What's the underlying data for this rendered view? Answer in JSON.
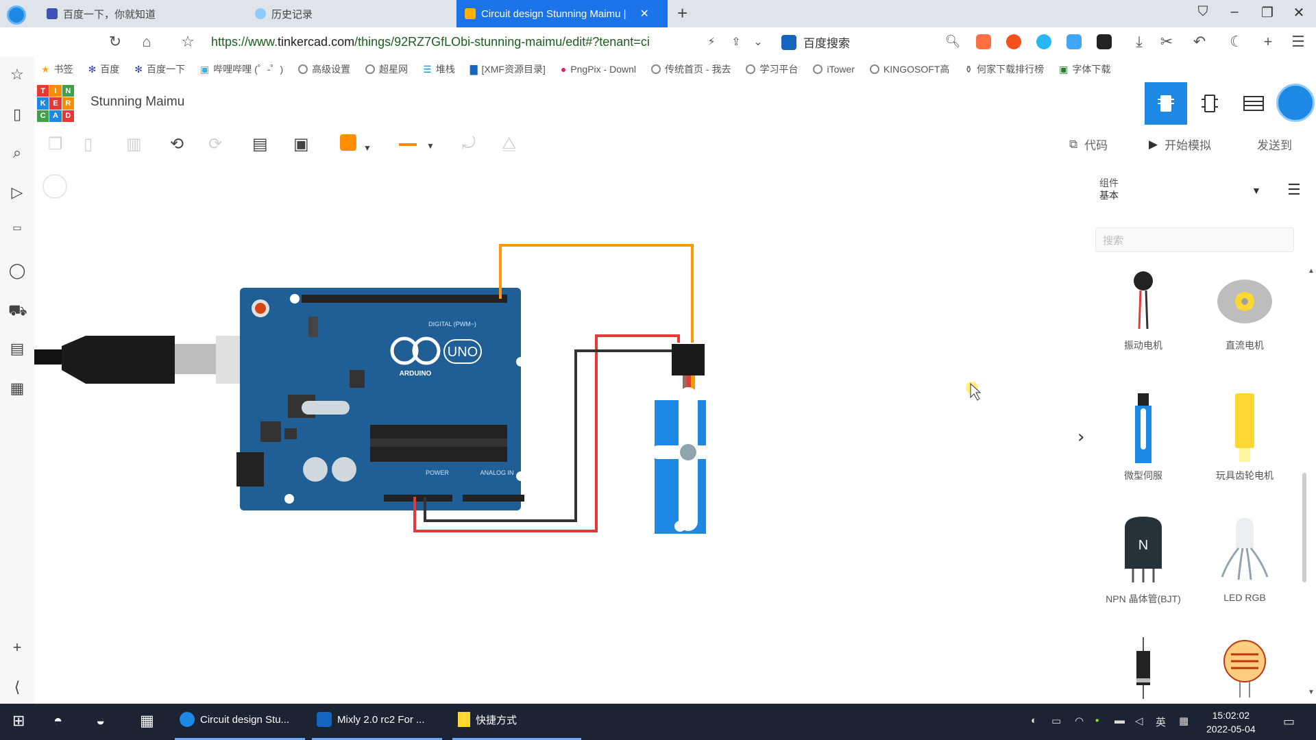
{
  "browser": {
    "tabs": [
      {
        "label": "百度一下，你就知道",
        "active": false
      },
      {
        "label": "历史记录",
        "active": false
      },
      {
        "label": "Circuit design Stunning Maimu |",
        "active": true
      }
    ],
    "url_prefix": "https://www.",
    "url_host": "tinkercad.com",
    "url_path": "/things/92RZ7GfLObi-stunning-maimu/edit#?tenant=ci",
    "search_engine_label": "百度搜索"
  },
  "bookmarks": [
    "书签",
    "百度",
    "百度一下",
    "哔哩哔哩 (゜-゜)",
    "高级设置",
    "超星网",
    "堆栈",
    "[XMF资源目录]",
    "PngPix - Downl",
    "传统首页 - 我去",
    "学习平台",
    "iTower",
    "KINGOSOFT高",
    "何家下载排行榜",
    "字体下载"
  ],
  "tinkercad": {
    "design_name": "Stunning Maimu",
    "logo_letters": [
      "T",
      "I",
      "N",
      "K",
      "E",
      "R",
      "C",
      "A",
      "D"
    ],
    "code_button": "代码",
    "simulate_button": "开始模拟",
    "send_button": "发送到"
  },
  "panel": {
    "category_label": "组件",
    "category_value": "基本",
    "search_placeholder": "搜索",
    "components": [
      {
        "name": "振动电机"
      },
      {
        "name": "直流电机"
      },
      {
        "name": "微型伺服"
      },
      {
        "name": "玩具齿轮电机"
      },
      {
        "name": "NPN 晶体管(BJT)"
      },
      {
        "name": "LED RGB"
      }
    ]
  },
  "canvas": {
    "arduino_brand": "ARDUINO",
    "arduino_model": "UNO",
    "digital_label": "DIGITAL (PWM~)",
    "power_label": "POWER",
    "analog_label": "ANALOG IN"
  },
  "taskbar": {
    "apps": [
      {
        "label": "Circuit design Stu..."
      },
      {
        "label": "Mixly 2.0 rc2 For ..."
      },
      {
        "label": "快捷方式"
      }
    ],
    "ime": "英",
    "time": "15:02:02",
    "date": "2022-05-04"
  },
  "colors": {
    "accent": "#1e88e5",
    "wire_orange": "#ff9800",
    "wire_red": "#e53935",
    "wire_black": "#333333",
    "arduino_blue": "#1f5f95"
  }
}
